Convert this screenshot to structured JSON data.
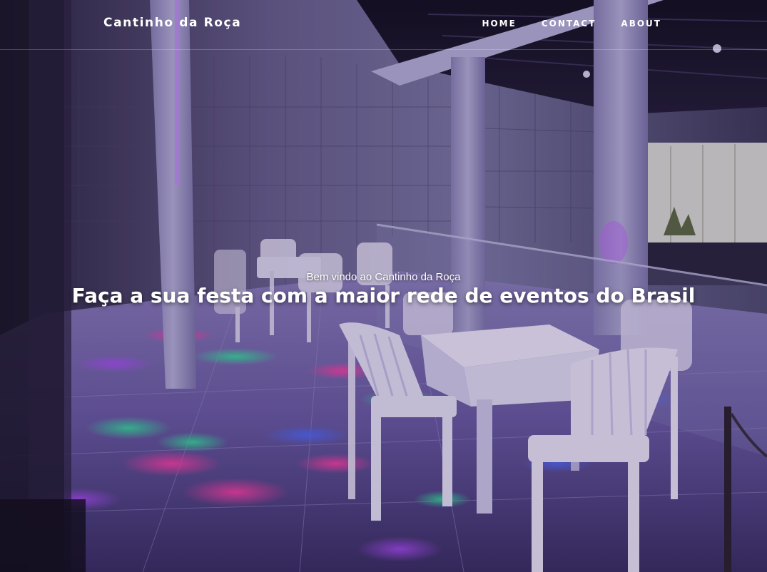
{
  "navbar": {
    "brand": "Cantinho da Roça",
    "links": [
      {
        "label": "HOME"
      },
      {
        "label": "CONTACT"
      },
      {
        "label": "ABOUT"
      }
    ]
  },
  "hero": {
    "subtitle": "Bem vindo ao Cantinho da Roça",
    "title": "Faça a sua festa com a maior rede de eventos do Brasil",
    "background_image": "party-venue-photo"
  },
  "colors": {
    "text": "#ffffff",
    "background": "#14101c",
    "accent_light": "#7a4cff"
  }
}
